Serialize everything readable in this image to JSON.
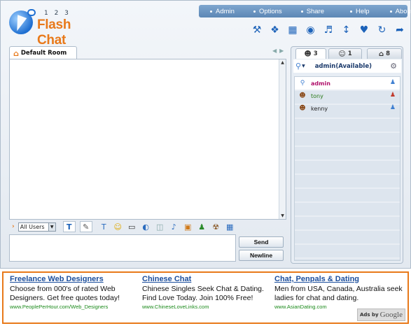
{
  "logo": {
    "number": "1 2 3",
    "text": "Flash Chat"
  },
  "menu": {
    "items": [
      "Admin",
      "Options",
      "Share",
      "Help",
      "About"
    ]
  },
  "toolbar": {
    "icons": [
      "wrench-icon",
      "gamepad-icon",
      "skin-icon",
      "webcam-icon",
      "volume-icon",
      "resize-icon",
      "heart-icon",
      "refresh-icon",
      "exit-icon"
    ]
  },
  "room": {
    "tab_label": "Default Room"
  },
  "input": {
    "recipient": "All Users",
    "send_label": "Send",
    "newline_label": "Newline",
    "format_label": "T"
  },
  "users_panel": {
    "tabs": [
      {
        "count": "3",
        "icon": "users-icon"
      },
      {
        "count": "1",
        "icon": "group-icon"
      },
      {
        "count": "8",
        "icon": "rooms-icon"
      }
    ],
    "self": "admin(Available)",
    "users": [
      {
        "name": "admin",
        "color": "#b0116b",
        "role": "user"
      },
      {
        "name": "tony",
        "color": "#2a7a1a",
        "role": "admin"
      },
      {
        "name": "kenny",
        "color": "#222222",
        "role": "user"
      }
    ]
  },
  "ads": [
    {
      "title": "Freelance Web Designers",
      "body": "Choose from 000's of rated Web Designers. Get free quotes today!",
      "url": "www.PeoplePerHour.com/Web_Designers"
    },
    {
      "title": "Chinese Chat",
      "body": "Chinese Singles Seek Chat & Dating. Find Love Today. Join 100% Free!",
      "url": "www.ChineseLoveLinks.com"
    },
    {
      "title": "Chat, Penpals & Dating",
      "body": "Men from USA, Canada, Australia seek ladies for chat and dating.",
      "url": "www.AsianDating.com"
    }
  ],
  "ads_by": {
    "label": "Ads by",
    "brand": "Google"
  }
}
